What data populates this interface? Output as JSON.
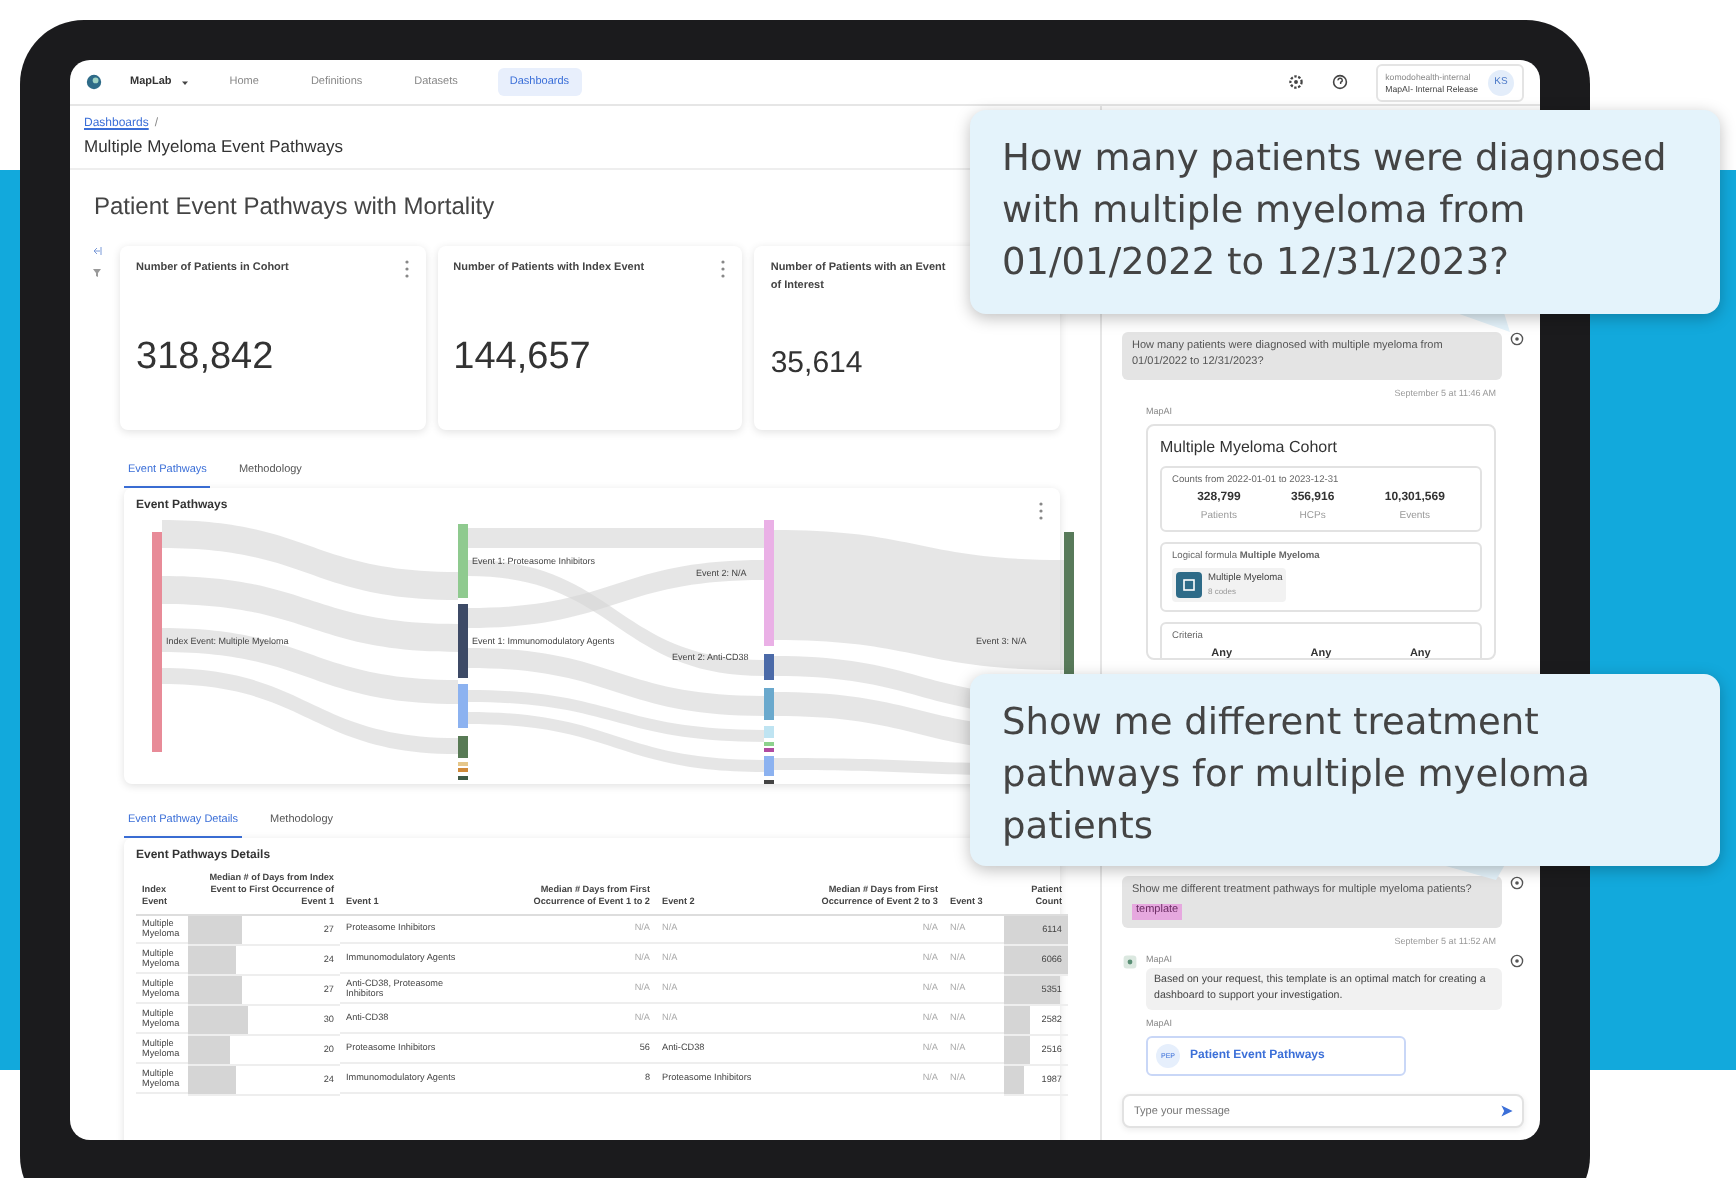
{
  "nav": {
    "app": "MapLab",
    "tabs": [
      {
        "label": "Home",
        "selected": false
      },
      {
        "label": "Definitions",
        "selected": false
      },
      {
        "label": "Datasets",
        "selected": false
      },
      {
        "label": "Dashboards",
        "selected": true
      }
    ],
    "org": "komodohealth-internal",
    "release": "MapAI- Internal Release",
    "initials": "KS"
  },
  "breadcrumb": {
    "link": "Dashboards",
    "separator": "/"
  },
  "page_title": "Multiple Myeloma Event Pathways",
  "dashboard_title": "Patient Event Pathways with Mortality",
  "stat_cards": [
    {
      "title": "Number of Patients in Cohort",
      "value": "318,842"
    },
    {
      "title": "Number of Patients with Index Event",
      "value": "144,657"
    },
    {
      "title": "Number of Patients with an Event of Interest",
      "value": "35,614"
    }
  ],
  "chart_tabs": [
    {
      "label": "Event Pathways",
      "selected": true
    },
    {
      "label": "Methodology",
      "selected": false
    }
  ],
  "sankey": {
    "title": "Event Pathways",
    "labels": [
      "Index Event: Multiple Myeloma",
      "Event 1: Proteasome Inhibitors",
      "Event 1: Immunomodulatory Agents",
      "Event 2: N/A",
      "Event 2: Anti-CD38",
      "Event 3: N/A"
    ]
  },
  "table_tabs": [
    {
      "label": "Event Pathway Details",
      "selected": true
    },
    {
      "label": "Methodology",
      "selected": false
    }
  ],
  "table": {
    "title": "Event Pathways Details",
    "columns": [
      "Index Event",
      "Median # of Days from Index Event to First Occurrence of Event 1",
      "Event 1",
      "Median # Days from First Occurrence of Event 1 to 2",
      "Event 2",
      "Median # Days from First Occurrence of Event 2 to 3",
      "Event 3",
      "Patient Count"
    ],
    "rows": [
      {
        "index_event": "Multiple Myeloma",
        "days_1": {
          "text": "27",
          "level": 0.36
        },
        "event_1": "Proteasome Inhibitors",
        "days_2": "N/A",
        "event_2": "N/A",
        "days_3": "N/A",
        "event_3": "N/A",
        "count": {
          "text": "6114",
          "level": 1
        }
      },
      {
        "index_event": "Multiple Myeloma",
        "days_1": {
          "text": "24",
          "level": 0.32
        },
        "event_1": "Immunomodulatory Agents",
        "days_2": "N/A",
        "event_2": "N/A",
        "days_3": "N/A",
        "event_3": "N/A",
        "count": {
          "text": "6066",
          "level": 0.99
        }
      },
      {
        "index_event": "Multiple Myeloma",
        "days_1": {
          "text": "27",
          "level": 0.36
        },
        "event_1": "Anti-CD38, Proteasome Inhibitors",
        "days_2": "N/A",
        "event_2": "N/A",
        "days_3": "N/A",
        "event_3": "N/A",
        "count": {
          "text": "5351",
          "level": 0.875
        }
      },
      {
        "index_event": "Multiple Myeloma",
        "days_1": {
          "text": "30",
          "level": 0.4
        },
        "event_1": "Anti-CD38",
        "days_2": "N/A",
        "event_2": "N/A",
        "days_3": "N/A",
        "event_3": "N/A",
        "count": {
          "text": "2582",
          "level": 0.42
        }
      },
      {
        "index_event": "Multiple Myeloma",
        "days_1": {
          "text": "20",
          "level": 0.27
        },
        "event_1": "Proteasome Inhibitors",
        "days_2": "56",
        "event_2": "Anti-CD38",
        "days_3": "N/A",
        "event_3": "N/A",
        "count": {
          "text": "2516",
          "level": 0.41
        }
      },
      {
        "index_event": "Multiple Myeloma",
        "days_1": {
          "text": "24",
          "level": 0.32
        },
        "event_1": "Immunomodulatory Agents",
        "days_2": "8",
        "event_2": "Proteasome Inhibitors",
        "days_3": "N/A",
        "event_3": "N/A",
        "count": {
          "text": "1987",
          "level": 0.325
        }
      }
    ]
  },
  "chat": {
    "items": [
      {
        "kind": "user",
        "text": "How many patients were diagnosed with multiple myeloma from 01/01/2022 to 12/31/2023?",
        "time": "September 5 at 11:46 AM"
      },
      {
        "kind": "cohort",
        "sender": "MapAI",
        "title": "Multiple Myeloma Cohort",
        "counts_label": "Counts from 2022-01-01 to 2023-12-31",
        "stats": [
          {
            "value": "328,799",
            "label": "Patients"
          },
          {
            "value": "356,916",
            "label": "HCPs"
          },
          {
            "value": "10,301,569",
            "label": "Events"
          }
        ],
        "formula_label": "Logical formula **Multiple Myeloma**",
        "formula_item": "Multiple Myeloma",
        "formula_codes": "8 codes",
        "criteria_label": "Criteria",
        "criteria": [
          "Any",
          "Any",
          "Any"
        ]
      },
      {
        "kind": "user",
        "text": "Show me different treatment pathways for multiple myeloma patients?",
        "tag": "template",
        "time": "September 5 at 11:52 AM"
      },
      {
        "kind": "bot",
        "sender": "MapAI",
        "text": "Based on your request, this template is an optimal match for creating a dashboard to support your investigation."
      },
      {
        "kind": "template",
        "sender": "MapAI",
        "badge": "PEP",
        "title": "Patient Event Pathways"
      }
    ],
    "input_placeholder": "Type your message"
  },
  "callouts": [
    "How many patients were diagnosed with multiple myeloma from 01/01/2022 to 12/31/2023?",
    "Show me different treatment pathways for multiple myeloma patients"
  ]
}
